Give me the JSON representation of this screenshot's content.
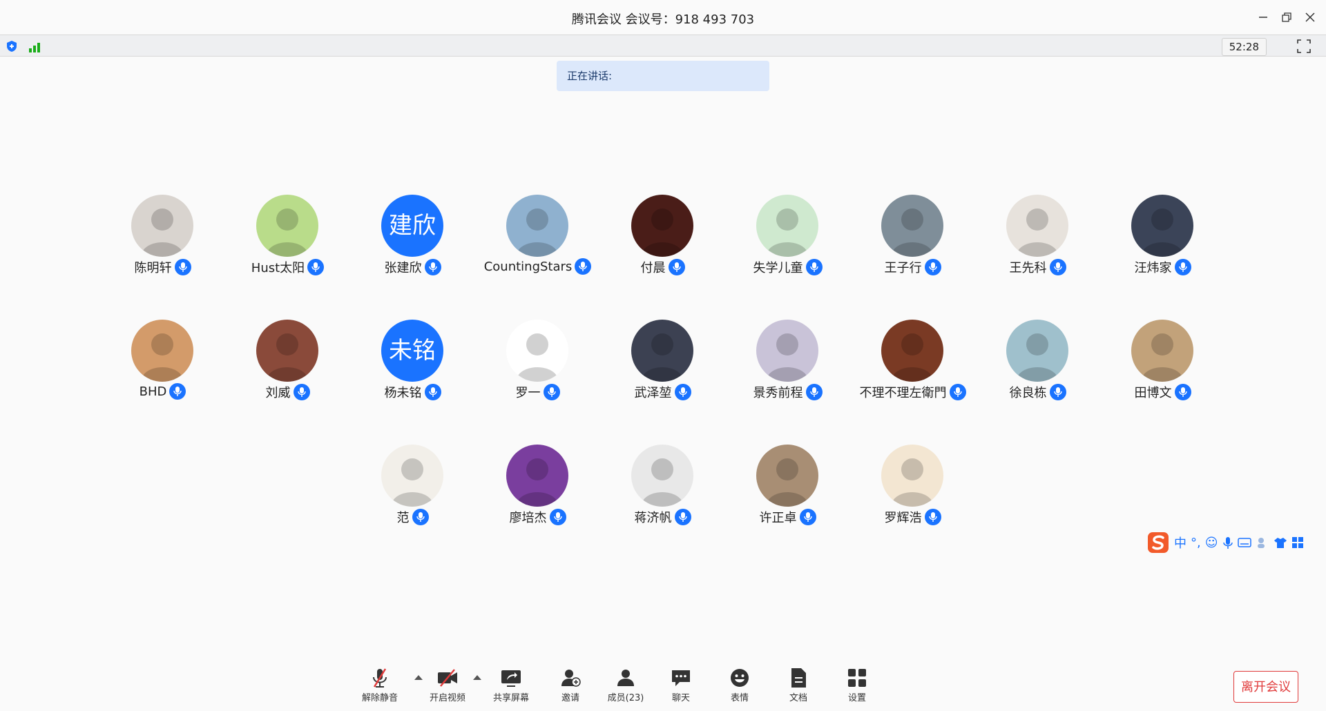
{
  "window": {
    "title": "腾讯会议 会议号：918 493 703",
    "timer": "52:28"
  },
  "speaking": {
    "label": "正在讲话:"
  },
  "participants": [
    {
      "name": "陈明轩",
      "avatar": "photo",
      "color": "#d9d4cf"
    },
    {
      "name": "Hust太阳",
      "avatar": "photo",
      "color": "#b9dc8a"
    },
    {
      "name": "张建欣",
      "avatar": "text",
      "initials": "建欣",
      "color": "#1a73ff"
    },
    {
      "name": "CountingStars",
      "avatar": "photo",
      "color": "#8fb1cf"
    },
    {
      "name": "付晨",
      "avatar": "photo",
      "color": "#4a1d18"
    },
    {
      "name": "失学儿童",
      "avatar": "photo",
      "color": "#cfe9cf"
    },
    {
      "name": "王子行",
      "avatar": "photo",
      "color": "#7f8e99"
    },
    {
      "name": "王先科",
      "avatar": "photo",
      "color": "#e7e2dc"
    },
    {
      "name": "汪炜家",
      "avatar": "photo",
      "color": "#3b4458"
    },
    {
      "name": "BHD",
      "avatar": "photo",
      "color": "#d39b6a"
    },
    {
      "name": "刘威",
      "avatar": "photo",
      "color": "#8a4a3a"
    },
    {
      "name": "杨未铭",
      "avatar": "text",
      "initials": "未铭",
      "color": "#1a73ff"
    },
    {
      "name": "罗一",
      "avatar": "photo",
      "color": "#ffffff"
    },
    {
      "name": "武泽堃",
      "avatar": "photo",
      "color": "#3c4152"
    },
    {
      "name": "景秀前程",
      "avatar": "photo",
      "color": "#c9c3d8"
    },
    {
      "name": "不理不理左衛門",
      "avatar": "photo",
      "color": "#7a3a24"
    },
    {
      "name": "徐良栋",
      "avatar": "photo",
      "color": "#9fc0cc"
    },
    {
      "name": "田博文",
      "avatar": "photo",
      "color": "#c2a27a"
    },
    {
      "name": "范",
      "avatar": "photo",
      "color": "#f2efe9"
    },
    {
      "name": "廖培杰",
      "avatar": "photo",
      "color": "#7a3e9e"
    },
    {
      "name": "蒋济帆",
      "avatar": "photo",
      "color": "#e8e8e8"
    },
    {
      "name": "许正卓",
      "avatar": "photo",
      "color": "#a88e74"
    },
    {
      "name": "罗辉浩",
      "avatar": "photo",
      "color": "#f3e6d2"
    }
  ],
  "ime": {
    "label": "中",
    "punct": "°,"
  },
  "toolbar": {
    "unmute": "解除静音",
    "video": "开启视频",
    "share": "共享屏幕",
    "invite": "邀请",
    "members": "成员(23)",
    "chat": "聊天",
    "emoji": "表情",
    "docs": "文档",
    "settings": "设置",
    "leave": "离开会议"
  },
  "colors": {
    "accent": "#1a73ff",
    "danger": "#e03a3a",
    "signal": "#1aad19"
  }
}
